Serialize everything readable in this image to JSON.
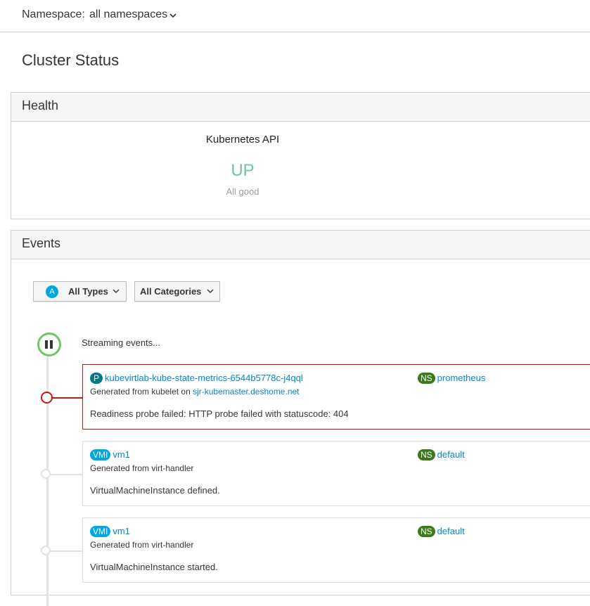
{
  "namespace": {
    "label": "Namespace:",
    "value": "all namespaces"
  },
  "page_title": "Cluster Status",
  "health": {
    "title": "Health",
    "item_name": "Kubernetes API",
    "status": "UP",
    "message": "All good",
    "status_color": "#6ec6a0"
  },
  "events": {
    "title": "Events",
    "types_filter": {
      "badge": "A",
      "label": "All Types"
    },
    "categories_filter": {
      "label": "All Categories"
    },
    "streaming_text": "Streaming events...",
    "items": [
      {
        "resource_badge": "P",
        "resource_name": "kubevirtlab-kube-state-metrics-6544b5778c-j4qql",
        "ns_badge": "NS",
        "namespace": "prometheus",
        "generated_prefix": "Generated from kubelet on ",
        "generated_host": "sjr-kubemaster.deshome.net",
        "message": "Readiness probe failed: HTTP probe failed with statuscode: 404",
        "severity": "warning"
      },
      {
        "resource_badge": "VMI",
        "resource_name": "vm1",
        "ns_badge": "NS",
        "namespace": "default",
        "generated_prefix": "Generated from virt-handler",
        "generated_host": "",
        "message": "VirtualMachineInstance defined.",
        "severity": "normal"
      },
      {
        "resource_badge": "VMI",
        "resource_name": "vm1",
        "ns_badge": "NS",
        "namespace": "default",
        "generated_prefix": "Generated from virt-handler",
        "generated_host": "",
        "message": "VirtualMachineInstance started.",
        "severity": "normal"
      }
    ]
  },
  "colors": {
    "link": "#0088ce",
    "warning": "#c9190b",
    "pod_badge": "#007a87",
    "vmi_badge": "#00a8e1",
    "ns_badge": "#3b7a1a",
    "stream_ring": "#6ec664"
  },
  "icons": {
    "namespace_caret": "chevron-down-icon",
    "pause": "pause-icon"
  }
}
